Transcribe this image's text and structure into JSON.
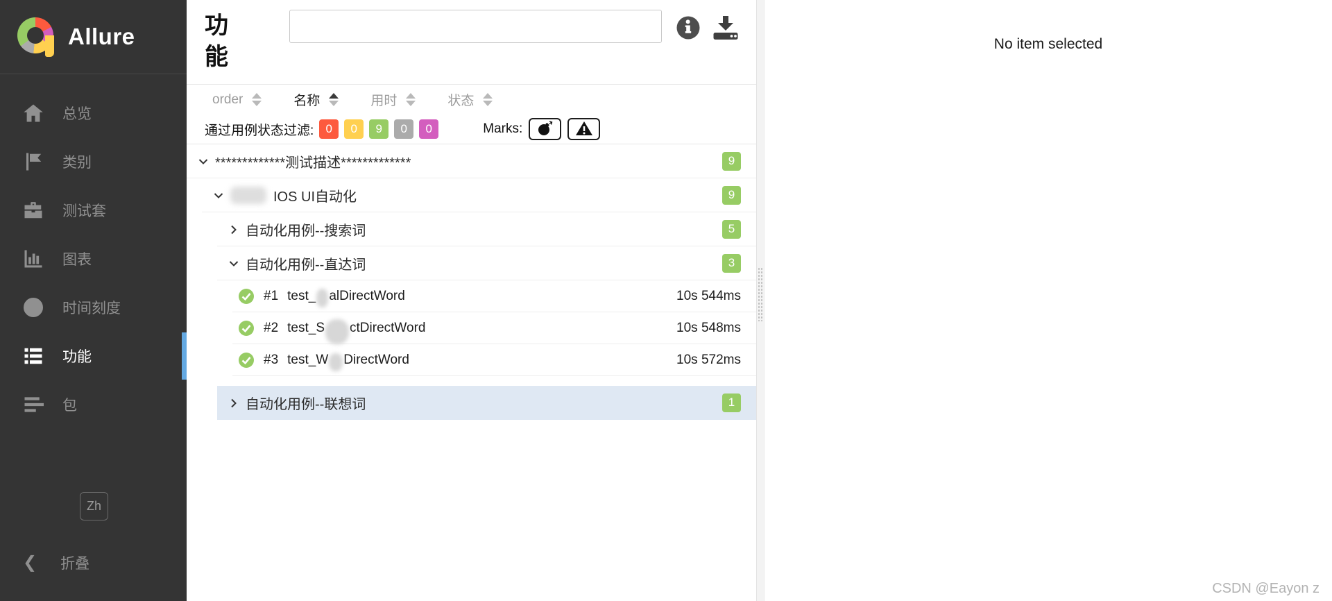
{
  "colors": {
    "sidebar_bg": "#343434",
    "accent_blue": "#64a9e2",
    "highlight_row": "#dfe8f3",
    "status_failed": "#fd5a3e",
    "status_broken": "#ffd050",
    "status_passed": "#97cc64",
    "status_skipped": "#ababab",
    "status_unknown": "#d35ebe"
  },
  "sidebar": {
    "logo_text": "Allure",
    "items": [
      {
        "label": "总览",
        "icon": "home-icon",
        "active": false
      },
      {
        "label": "类别",
        "icon": "flag-icon",
        "active": false
      },
      {
        "label": "测试套",
        "icon": "briefcase-icon",
        "active": false
      },
      {
        "label": "图表",
        "icon": "bar-chart-icon",
        "active": false
      },
      {
        "label": "时间刻度",
        "icon": "clock-icon",
        "active": false
      },
      {
        "label": "功能",
        "icon": "list-icon",
        "active": true
      },
      {
        "label": "包",
        "icon": "align-lines-icon",
        "active": false
      }
    ],
    "lang_button": "Zh",
    "collapse_label": "折叠"
  },
  "panel": {
    "title": "功能",
    "search_value": "",
    "search_placeholder": "",
    "sort": [
      {
        "label": "order",
        "active": false
      },
      {
        "label": "名称",
        "active": true,
        "direction": "asc"
      },
      {
        "label": "用时",
        "active": false
      },
      {
        "label": "状态",
        "active": false
      }
    ],
    "filter_label": "通过用例状态过滤:",
    "statuses": [
      {
        "name": "failed",
        "count": "0",
        "color": "#fd5a3e"
      },
      {
        "name": "broken",
        "count": "0",
        "color": "#ffd050"
      },
      {
        "name": "passed",
        "count": "9",
        "color": "#97cc64"
      },
      {
        "name": "skipped",
        "count": "0",
        "color": "#ababab"
      },
      {
        "name": "unknown",
        "count": "0",
        "color": "#d35ebe"
      }
    ],
    "marks_label": "Marks:",
    "tree": {
      "root": {
        "name": "*************测试描述*************",
        "count": "9",
        "expanded": true
      },
      "ios": {
        "name": "IOS UI自动化",
        "count": "9",
        "expanded": true,
        "censored_prefix": true
      },
      "search_group": {
        "name": "自动化用例--搜索词",
        "count": "5",
        "expanded": false
      },
      "direct_group": {
        "name": "自动化用例--直达词",
        "count": "3",
        "expanded": true
      },
      "assoc_group": {
        "name": "自动化用例--联想词",
        "count": "1",
        "expanded": false,
        "highlighted": true
      },
      "tests": [
        {
          "order": "#1",
          "status": "passed",
          "name_prefix": "test_",
          "name_suffix": "alDirectWord",
          "duration": "10s 544ms"
        },
        {
          "order": "#2",
          "status": "passed",
          "name_prefix": "test_S",
          "name_suffix": "ctDirectWord",
          "duration": "10s 548ms"
        },
        {
          "order": "#3",
          "status": "passed",
          "name_prefix": "test_W",
          "name_suffix": "DirectWord",
          "duration": "10s 572ms"
        }
      ]
    }
  },
  "detail": {
    "empty_message": "No item selected"
  },
  "watermark": "CSDN @Eayon z"
}
